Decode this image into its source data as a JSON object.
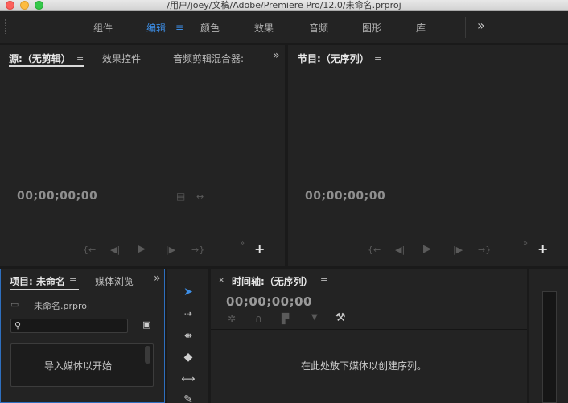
{
  "window": {
    "title": "/用户/joey/文稿/Adobe/Premiere Pro/12.0/未命名.prproj"
  },
  "workspaces": {
    "items": [
      "组件",
      "编辑",
      "颜色",
      "效果",
      "音频",
      "图形",
      "库"
    ],
    "active": "编辑",
    "more_icon": "»",
    "accent_color": "#3d8ee6"
  },
  "source_panel": {
    "tabs": [
      "源:（无剪辑）",
      "效果控件",
      "音频剪辑混合器:"
    ],
    "timecode": "00;00;00;00",
    "more_icon": "»"
  },
  "program_panel": {
    "tab": "节目:（无序列）",
    "timecode": "00;00;00;00"
  },
  "project_panel": {
    "tabs": [
      "项目: 未命名",
      "媒体浏览"
    ],
    "file_name": "未命名.prproj",
    "drop_hint": "导入媒体以开始",
    "more_icon": "»"
  },
  "timeline_panel": {
    "tab": "时间轴:（无序列）",
    "timecode": "00;00;00;00",
    "empty_hint": "在此处放下媒体以创建序列。",
    "close_icon": "×"
  }
}
